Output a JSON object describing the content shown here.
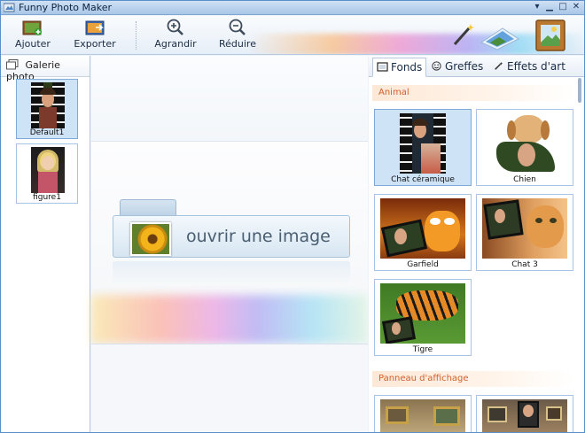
{
  "window": {
    "title": "Funny Photo Maker"
  },
  "toolbar": {
    "add_label": "Ajouter",
    "export_label": "Exporter",
    "zoom_in_label": "Agrandir",
    "zoom_out_label": "Réduire"
  },
  "gallery": {
    "title": "Galerie photo",
    "items": [
      {
        "label": "Default1",
        "selected": true
      },
      {
        "label": "figure1",
        "selected": false
      }
    ]
  },
  "canvas": {
    "open_label": "ouvrir une image"
  },
  "right_panel": {
    "tabs": [
      {
        "label": "Fonds",
        "active": true
      },
      {
        "label": "Greffes",
        "active": false
      },
      {
        "label": "Effets d'art",
        "active": false
      }
    ],
    "categories": [
      {
        "title": "Animal",
        "items": [
          "Chat céramique",
          "Chien",
          "Garfield",
          "Chat 3",
          "Tigre"
        ]
      },
      {
        "title": "Panneau d'affichage",
        "items": []
      }
    ]
  },
  "colors": {
    "accent": "#5a8fc8",
    "selection": "#cfe3f7",
    "category_text": "#d0602a"
  }
}
